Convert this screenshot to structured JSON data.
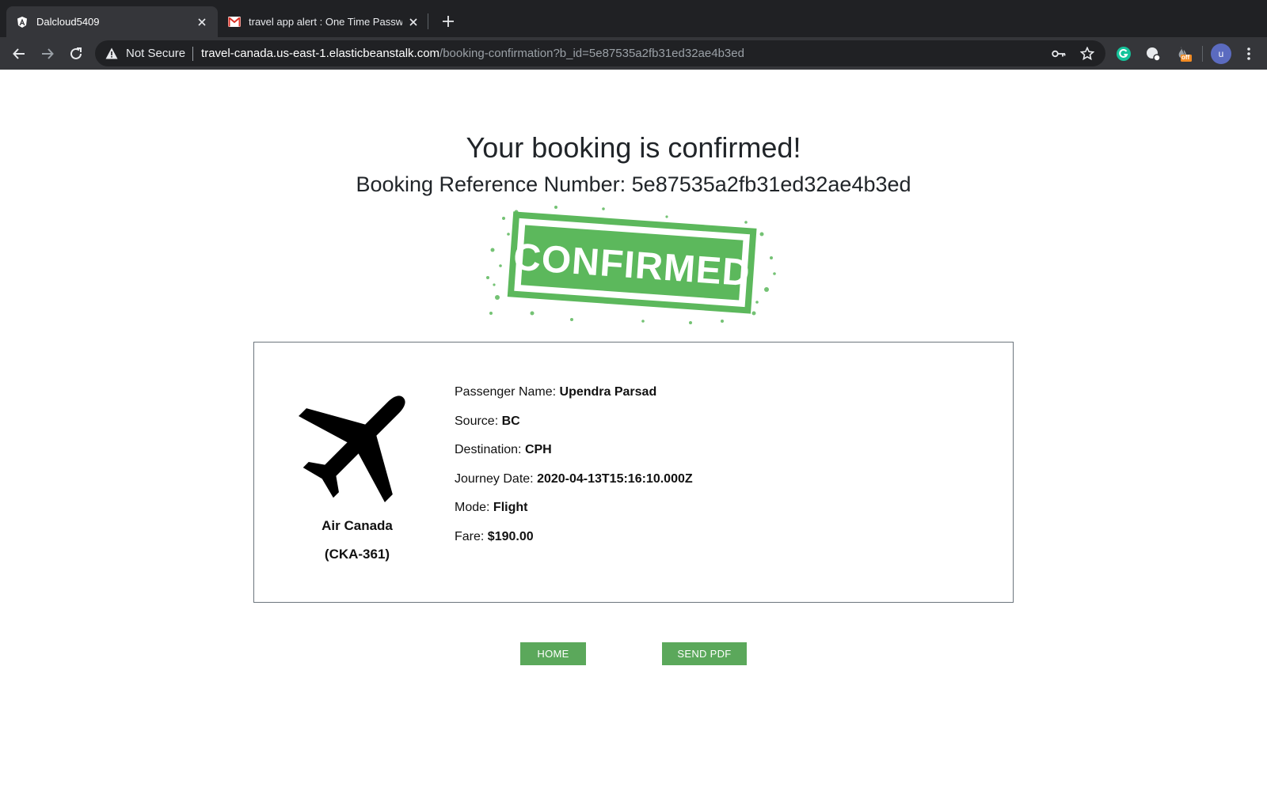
{
  "browser": {
    "tabs": [
      {
        "title": "Dalcloud5409",
        "active": true,
        "favicon": "angular-logo-icon"
      },
      {
        "title": "travel app alert : One Time Passw",
        "active": false,
        "favicon": "gmail-icon"
      }
    ],
    "address_bar": {
      "security_label": "Not Secure",
      "host": "travel-canada.us-east-1.elasticbeanstalk.com",
      "path": "/booking-confirmation?b_id=5e87535a2fb31ed32ae4b3ed"
    },
    "extension_badge": "off",
    "profile_initial": "u"
  },
  "booking": {
    "headline": "Your booking is confirmed!",
    "reference_label": "Booking Reference Number: ",
    "reference_number": "5e87535a2fb31ed32ae4b3ed",
    "stamp_text": "CONFIRMED",
    "carrier_name": "Air Canada",
    "carrier_code": "(CKA-361)",
    "details": [
      {
        "label": "Passenger Name: ",
        "value": "Upendra Parsad"
      },
      {
        "label": "Source: ",
        "value": "BC"
      },
      {
        "label": "Destination: ",
        "value": "CPH"
      },
      {
        "label": "Journey Date: ",
        "value": "2020-04-13T15:16:10.000Z"
      },
      {
        "label": "Mode: ",
        "value": "Flight"
      },
      {
        "label": "Fare: ",
        "value": "$190.00"
      }
    ]
  },
  "actions": {
    "home_label": "HOME",
    "send_pdf_label": "SEND PDF"
  },
  "colors": {
    "accent_green": "#5ba85b",
    "stamp_green": "#5cb85c",
    "chrome_dark": "#202124",
    "chrome_toolbar": "#35363a"
  }
}
